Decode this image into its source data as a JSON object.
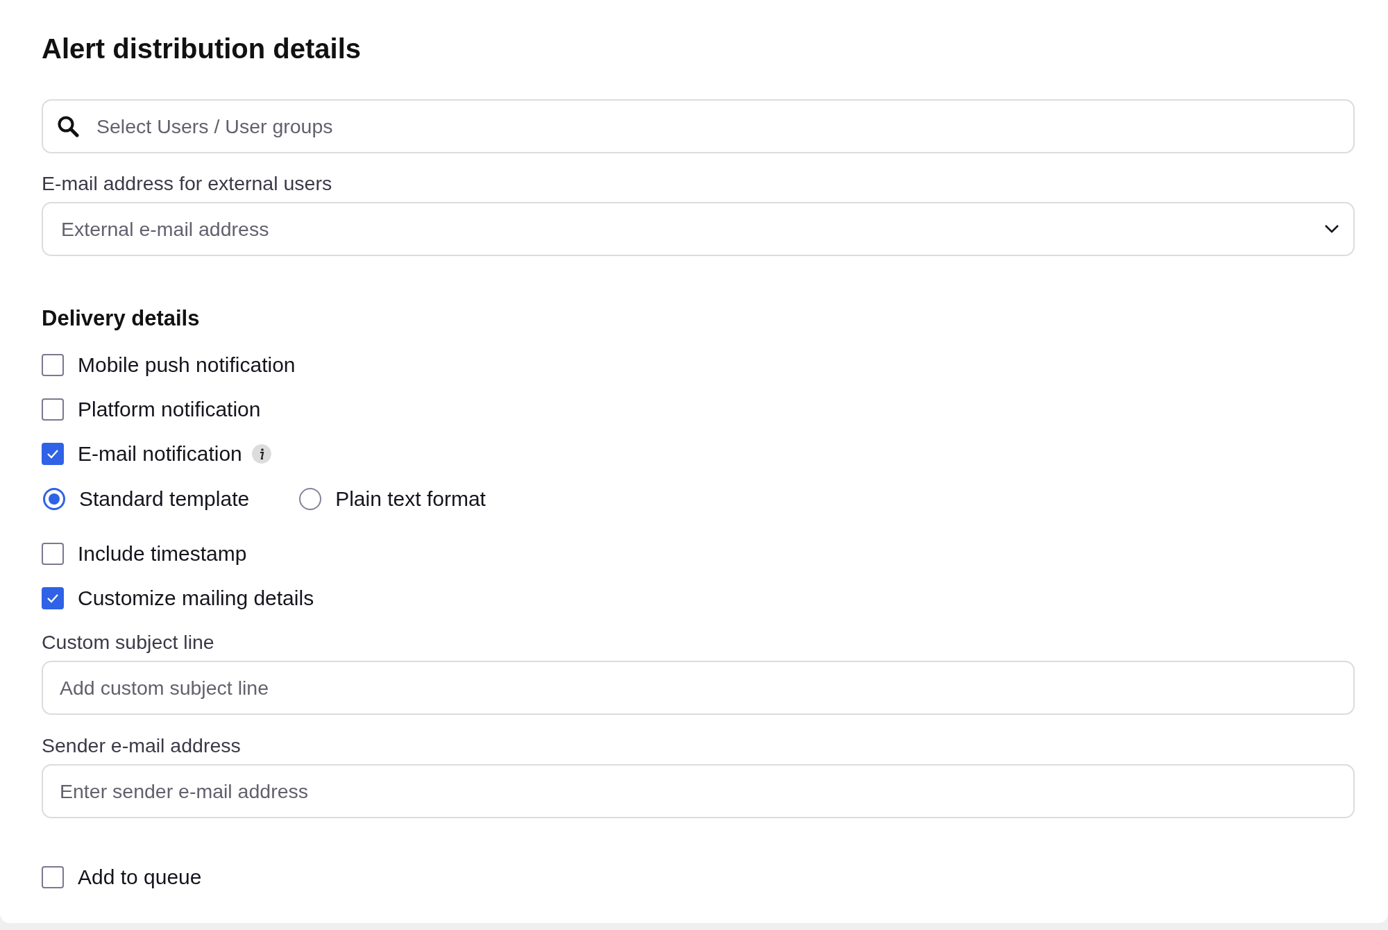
{
  "title": "Alert distribution details",
  "items": [
    {
      "kind": "search",
      "placeholder": "Select Users / User groups"
    },
    {
      "kind": "select",
      "label": "E-mail address for external users",
      "placeholder": "External e-mail address"
    },
    {
      "kind": "heading",
      "text": "Delivery details"
    },
    {
      "kind": "checkbox",
      "label": "Mobile push notification",
      "checked": false
    },
    {
      "kind": "checkbox",
      "label": "Platform notification",
      "checked": false
    },
    {
      "kind": "checkbox",
      "label": "E-mail notification",
      "checked": true,
      "info": true
    },
    {
      "kind": "radio_group",
      "options": [
        {
          "label": "Standard template",
          "selected": true
        },
        {
          "label": "Plain text format",
          "selected": false
        }
      ]
    },
    {
      "kind": "checkbox",
      "label": "Include timestamp",
      "checked": false
    },
    {
      "kind": "checkbox",
      "label": "Customize mailing details",
      "checked": true
    },
    {
      "kind": "text",
      "label": "Custom subject line",
      "placeholder": "Add custom subject line"
    },
    {
      "kind": "text",
      "label": "Sender e-mail address",
      "placeholder": "Enter sender e-mail address"
    },
    {
      "kind": "checkbox",
      "label": "Add to queue",
      "checked": false
    }
  ]
}
